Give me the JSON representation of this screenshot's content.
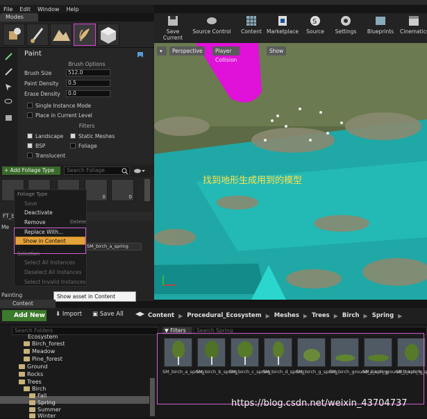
{
  "menu": [
    "File",
    "Edit",
    "Window",
    "Help"
  ],
  "modes_tab": "Modes",
  "paint": {
    "title": "Paint",
    "brush_options": "Brush Options",
    "brush_size_label": "Brush Size",
    "brush_size_value": "512.0",
    "paint_density_label": "Paint Density",
    "paint_density_value": "0.5",
    "erase_density_label": "Erase Density",
    "erase_density_value": "0.0",
    "single_instance": "Single Instance Mode",
    "place_current_level": "Place in Current Level",
    "filters_title": "Filters",
    "landscape": "Landscape",
    "static_meshes": "Static Meshes",
    "bsp": "BSP",
    "foliage": "Foliage",
    "translucent": "Translucent"
  },
  "foliage_bar": {
    "add_label": "+ Add Foliage Type",
    "search_placeholder": "Search Foliage"
  },
  "foliage_counts": [
    "0",
    "0",
    "0"
  ],
  "left_misc": {
    "ft_label": "FT_bi",
    "me_label": "Me",
    "mesh_value": "SM_birch_a_spring",
    "painting": "Painting"
  },
  "context_menu": {
    "foliage_type": "Foliage Type",
    "save": "Save",
    "deactivate": "Deactivate",
    "remove": "Remove",
    "remove_shortcut": "Delete",
    "replace_with": "Replace With...",
    "show_in_cb": "Show in Content Browser",
    "selection": "Selection",
    "select_all": "Select All Instances",
    "deselect_all": "Deselect All Instances",
    "select_invalid": "Select Invalid Instances"
  },
  "tooltip": "Show asset in Content Browser.",
  "toolbar": [
    {
      "label": "Save Current"
    },
    {
      "label": "Source Control"
    },
    {
      "label": "Content"
    },
    {
      "label": "Marketplace"
    },
    {
      "label": "Source"
    },
    {
      "label": "Settings"
    },
    {
      "label": "Blueprints"
    },
    {
      "label": "Cinematics"
    }
  ],
  "viewport": {
    "perspective": "Perspective",
    "player_collision": "Player Collision",
    "show": "Show",
    "annotation": "找到地形生成用到的模型"
  },
  "content_browser": {
    "tab": "Content Browser",
    "add_new": "Add New",
    "import": "Import",
    "save_all": "Save All",
    "breadcrumb": [
      "Content",
      "Procedural_Ecosystem",
      "Meshes",
      "Trees",
      "Birch",
      "Spring"
    ],
    "search_folders": "Search Folders",
    "filters": "Filters",
    "search_assets": "Search Spring",
    "tree": [
      "Ecosystem",
      "Birch_forest",
      "Meadow",
      "Pine_forest",
      "Ground",
      "Rocks",
      "Trees",
      "Birch",
      "Fall",
      "Spring",
      "Summer",
      "Winter"
    ],
    "assets": [
      "SM_birch_a_spring",
      "SM_birch_b_spring",
      "SM_birch_c_spring",
      "SM_birch_d_spring",
      "SM_birch_g_spring",
      "SM_birch_ground_a_spring",
      "SM_birch_ground_b_spring",
      "SM_birch_h_spring"
    ]
  },
  "watermark": "https://blog.csdn.net/weixin_43704737",
  "colors": {
    "accent_pink": "#e040e0",
    "highlight_orange": "#e3a23a",
    "add_green": "#3c7a2c",
    "teal_ground": "#1fb3b0"
  }
}
